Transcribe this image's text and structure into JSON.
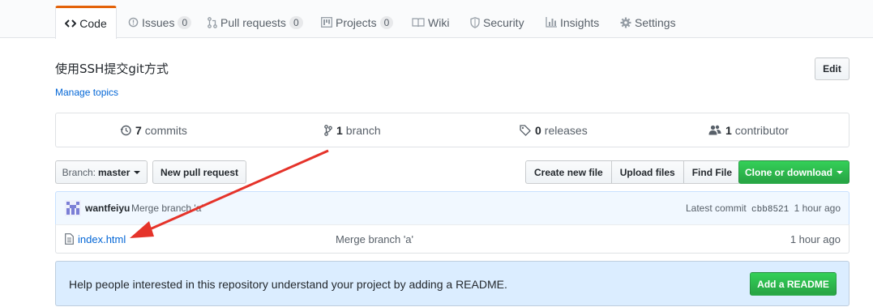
{
  "tabs": [
    {
      "label": "Code",
      "icon": "code-icon"
    },
    {
      "label": "Issues",
      "count": "0",
      "icon": "issue-icon"
    },
    {
      "label": "Pull requests",
      "count": "0",
      "icon": "pull-request-icon"
    },
    {
      "label": "Projects",
      "count": "0",
      "icon": "project-icon"
    },
    {
      "label": "Wiki",
      "icon": "book-icon"
    },
    {
      "label": "Security",
      "icon": "shield-icon"
    },
    {
      "label": "Insights",
      "icon": "graph-icon"
    },
    {
      "label": "Settings",
      "icon": "gear-icon"
    }
  ],
  "repo": {
    "description": "使用SSH提交git方式",
    "manage_topics": "Manage topics",
    "edit_label": "Edit"
  },
  "numbers": {
    "commits": {
      "count": "7",
      "label": "commits"
    },
    "branches": {
      "count": "1",
      "label": "branch"
    },
    "releases": {
      "count": "0",
      "label": "releases"
    },
    "contributors": {
      "count": "1",
      "label": "contributor"
    }
  },
  "toolbar": {
    "branch_prefix": "Branch:",
    "branch_name": "master",
    "new_pr": "New pull request",
    "create_file": "Create new file",
    "upload_files": "Upload files",
    "find_file": "Find File",
    "clone": "Clone or download"
  },
  "commit": {
    "author": "wantfeiyu",
    "message": "Merge branch 'a'",
    "latest_label": "Latest commit",
    "sha": "cbb8521",
    "age": "1 hour ago"
  },
  "files": [
    {
      "name": "index.html",
      "message": "Merge branch 'a'",
      "age": "1 hour ago"
    }
  ],
  "readme": {
    "text": "Help people interested in this repository understand your project by adding a README.",
    "button": "Add a README"
  },
  "colors": {
    "accent_tab": "#e36209",
    "link": "#0366d6",
    "primary_green": "#28a745",
    "annotation_arrow": "#e5332a"
  }
}
